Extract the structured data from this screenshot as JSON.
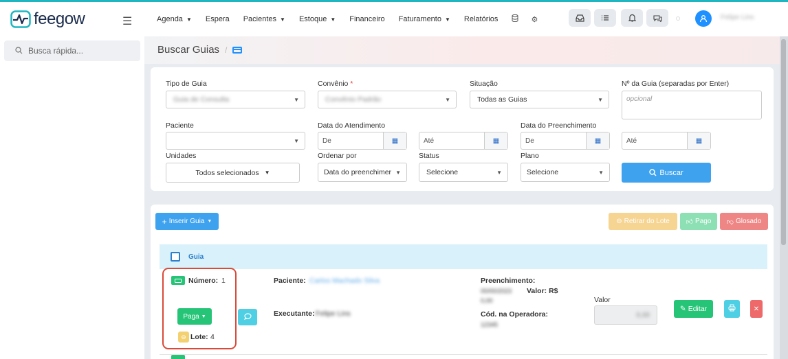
{
  "app": {
    "logo_text": "feegow",
    "brand_color": "#1fb6c1",
    "username": "Felipe Lins"
  },
  "nav": {
    "items": [
      {
        "label": "Agenda",
        "dropdown": true
      },
      {
        "label": "Espera",
        "dropdown": false
      },
      {
        "label": "Pacientes",
        "dropdown": true
      },
      {
        "label": "Estoque",
        "dropdown": true
      },
      {
        "label": "Financeiro",
        "dropdown": false
      },
      {
        "label": "Faturamento",
        "dropdown": true
      },
      {
        "label": "Relatórios",
        "dropdown": false
      }
    ],
    "icons": [
      "database-icon",
      "gear-icon",
      "inbox-icon",
      "checklist-icon",
      "bell-icon",
      "chat-icon",
      "user-icon"
    ]
  },
  "sidebar": {
    "search_placeholder": "Busca rápida..."
  },
  "page": {
    "title": "Buscar Guias"
  },
  "filters": {
    "tipo_guia": {
      "label": "Tipo de Guia",
      "value": "Guia de Consulta"
    },
    "convenio": {
      "label": "Convênio",
      "required_mark": "*",
      "value": "Convênio Padrão"
    },
    "situacao": {
      "label": "Situação",
      "value": "Todas as Guias"
    },
    "num_guia": {
      "label": "Nº da Guia (separadas por Enter)",
      "placeholder": "opcional"
    },
    "paciente": {
      "label": "Paciente",
      "value": ""
    },
    "data_atendimento": {
      "label": "Data do Atendimento",
      "de": "De",
      "ate": "Até"
    },
    "data_preenchimento": {
      "label": "Data do Preenchimento",
      "de": "De",
      "ate": "Até"
    },
    "unidades": {
      "label": "Unidades",
      "value": "Todos selecionados"
    },
    "ordenar": {
      "label": "Ordenar por",
      "value": "Data do preenchimer"
    },
    "status": {
      "label": "Status",
      "value": "Selecione"
    },
    "plano": {
      "label": "Plano",
      "value": "Selecione"
    },
    "buscar_label": "Buscar"
  },
  "actions": {
    "inserir": "Inserir Guia",
    "retirar": "Retirar do Lote",
    "pago": "Pago",
    "glosado": "Glosado"
  },
  "table": {
    "header": "Guia"
  },
  "row": {
    "numero_label": "Número:",
    "numero": "1",
    "status_label": "Paga",
    "lote_label": "Lote:",
    "lote": "4",
    "paciente_label": "Paciente:",
    "paciente": "Carlos Machado Silva",
    "executante_label": "Executante:",
    "executante": "Felipe Lins",
    "preenchimento_label": "Preenchimento:",
    "preenchimento_date": "00/00/2023",
    "valor_inline_label": "Valor: R$",
    "valor_inline": "0,00",
    "cod_label": "Cód. na Operadora:",
    "cod": "12345",
    "valor_label": "Valor",
    "valor": "0,00",
    "editar": "Editar"
  }
}
